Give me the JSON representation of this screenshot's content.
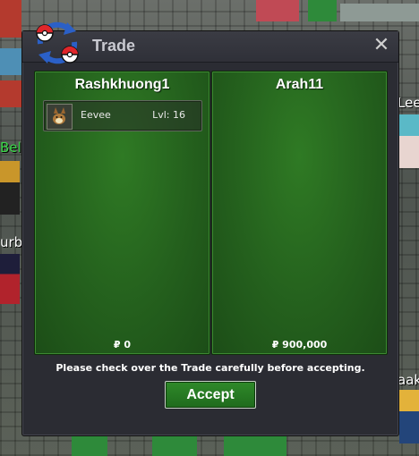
{
  "window": {
    "title": "Trade",
    "close_symbol": "✕",
    "logo_icon": "trade-pokeball-arrows-icon"
  },
  "left_panel": {
    "player_name": "Rashkhuong1",
    "items": [
      {
        "name": "Eevee",
        "level": "Lvl: 16",
        "icon": "eevee-icon"
      }
    ],
    "money": "₽ 0"
  },
  "right_panel": {
    "player_name": "Arah11",
    "items": [],
    "money": "₽ 900,000"
  },
  "notice": "Please check over the Trade carefully before accepting.",
  "accept_label": "Accept",
  "world_labels": {
    "right_top": "Lee",
    "left_top": "Beltu",
    "left_mid": "urbo",
    "right_bottom": "aak"
  },
  "colors": {
    "panel_green": "#24601d",
    "window_bg": "#2b2c33",
    "accept_green": "#2f8a2a"
  }
}
